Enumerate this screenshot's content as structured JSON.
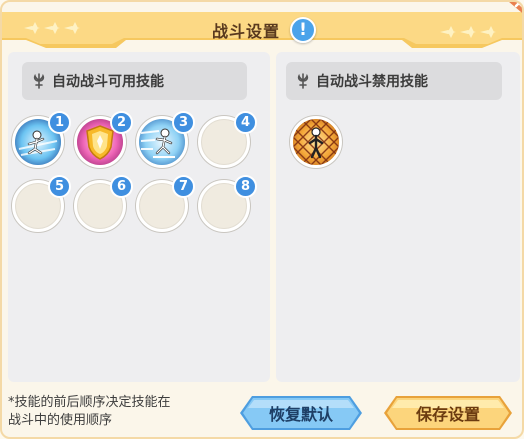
{
  "header": {
    "title": "战斗设置",
    "info_label": "!"
  },
  "available_panel": {
    "label": "自动战斗可用技能",
    "slots": [
      {
        "number": "1",
        "icon": "ice-skater-skill-icon",
        "filled": true
      },
      {
        "number": "2",
        "icon": "golden-shield-skill-icon",
        "filled": true
      },
      {
        "number": "3",
        "icon": "ice-dash-skill-icon",
        "filled": true
      },
      {
        "number": "4",
        "icon": "",
        "filled": false
      },
      {
        "number": "5",
        "icon": "",
        "filled": false
      },
      {
        "number": "6",
        "icon": "",
        "filled": false
      },
      {
        "number": "7",
        "icon": "",
        "filled": false
      },
      {
        "number": "8",
        "icon": "",
        "filled": false
      }
    ]
  },
  "disabled_panel": {
    "label": "自动战斗禁用技能",
    "slots": [
      {
        "icon": "net-trap-skill-icon",
        "filled": true
      }
    ]
  },
  "footer": {
    "note_line1": "*技能的前后顺序决定技能在",
    "note_line2": "战斗中的使用顺序",
    "restore_label": "恢复默认",
    "save_label": "保存设置"
  },
  "colors": {
    "badge": "#3f8fe0",
    "ribbon": "#fbd27a",
    "restore_button": "#7ec3f4",
    "save_button": "#fbd27a"
  }
}
